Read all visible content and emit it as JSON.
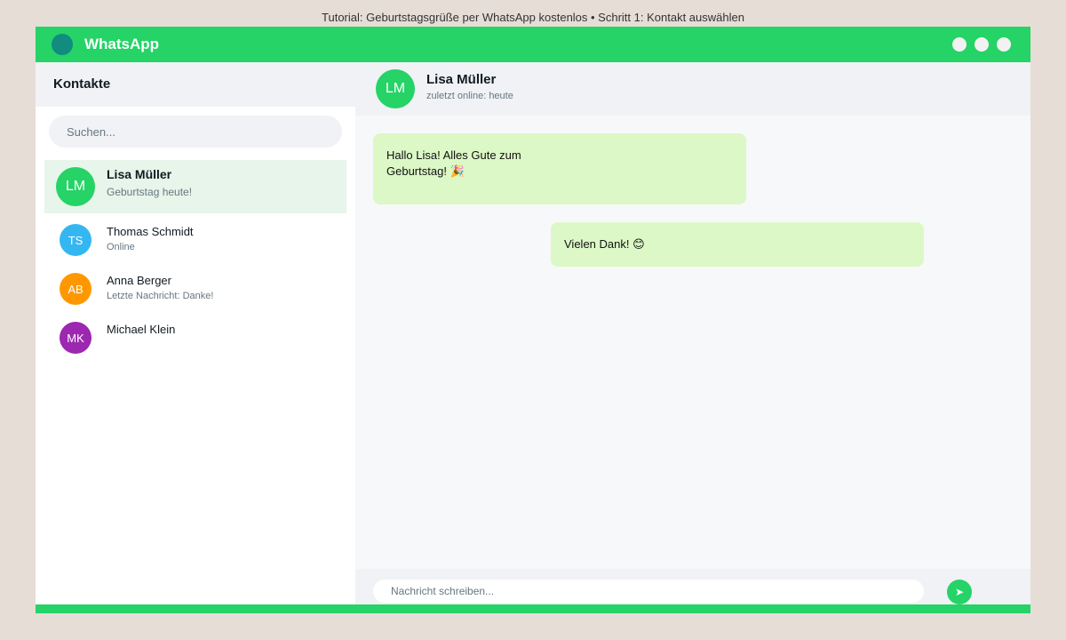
{
  "caption": "Tutorial: Geburtstagsgrüße per WhatsApp kostenlos • Schritt 1: Kontakt auswählen",
  "titlebar": {
    "app_name": "WhatsApp",
    "logo_color": "#128c7e",
    "accent_color": "#25d366",
    "window_controls": [
      "minimize-dot",
      "maximize-dot",
      "close-dot"
    ]
  },
  "sidebar": {
    "title": "Kontakte",
    "search_placeholder": "Suchen...",
    "contacts": [
      {
        "initials": "LM",
        "name": "Lisa Müller",
        "subtitle": "Geburtstag heute!",
        "avatar_color": "#25d366",
        "selected": true
      },
      {
        "initials": "TS",
        "name": "Thomas Schmidt",
        "subtitle": "Online",
        "avatar_color": "#34b7f1",
        "selected": false
      },
      {
        "initials": "AB",
        "name": "Anna Berger",
        "subtitle": "Letzte Nachricht: Danke!",
        "avatar_color": "#ff9800",
        "selected": false
      },
      {
        "initials": "MK",
        "name": "Michael Klein",
        "subtitle": "",
        "avatar_color": "#9c27b0",
        "selected": false
      }
    ]
  },
  "chat": {
    "initials": "LM",
    "name": "Lisa Müller",
    "status": "zuletzt online: heute",
    "avatar_color": "#25d366",
    "messages": [
      {
        "text_line1": "Hallo Lisa! Alles Gute zum",
        "text_line2": "Geburtstag! 🎉",
        "bubble_color": "#dcf8c6"
      },
      {
        "text": "Vielen Dank! 😊",
        "bubble_color": "#dcf8c6"
      }
    ],
    "input_placeholder": "Nachricht schreiben...",
    "send_icon": "send-arrow-icon"
  }
}
